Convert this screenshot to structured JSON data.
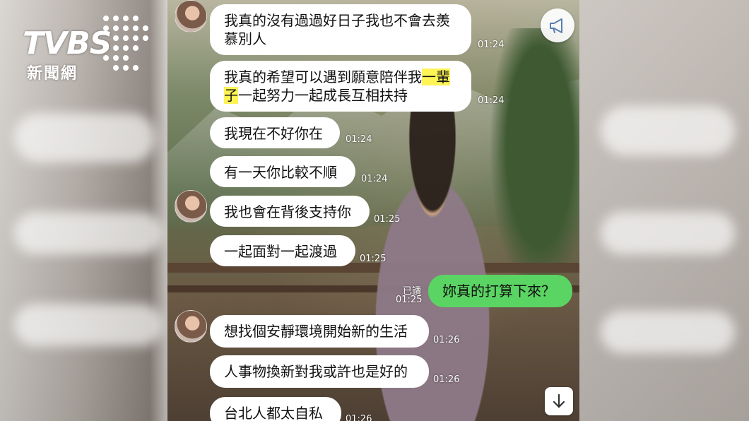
{
  "overlay": {
    "brand": "TVBS",
    "brand_sub": "新聞網"
  },
  "chat": {
    "messages": [
      {
        "text": "我真的沒有過過好日子我也不會去羨慕別人",
        "time": "01:24"
      },
      {
        "text_a": "我真的希望可以遇到願意陪伴我",
        "text_hl": "一輩子",
        "text_b": "一起努力一起成長互相扶持",
        "time": "01:24"
      },
      {
        "text": "我現在不好你在",
        "time": "01:24"
      },
      {
        "text": "有一天你比較不順",
        "time": "01:24"
      },
      {
        "text": "我也會在背後支持你",
        "time": "01:25"
      },
      {
        "text": "一起面對一起渡過",
        "time": "01:25"
      },
      {
        "text": "妳真的打算下來？",
        "time": "01:25",
        "read": "已讀"
      },
      {
        "text": "想找個安靜環境開始新的生活",
        "time": "01:26"
      },
      {
        "text": "人事物換新對我或許也是好的",
        "time": "01:26"
      },
      {
        "text": "台北人都太自私",
        "time": "01:26"
      }
    ]
  },
  "icons": {
    "megaphone": "megaphone-icon",
    "scroll_down": "arrow-down-icon"
  },
  "colors": {
    "sent_bubble": "#5ad463",
    "received_bubble": "#ffffff",
    "highlight": "#fff455"
  }
}
